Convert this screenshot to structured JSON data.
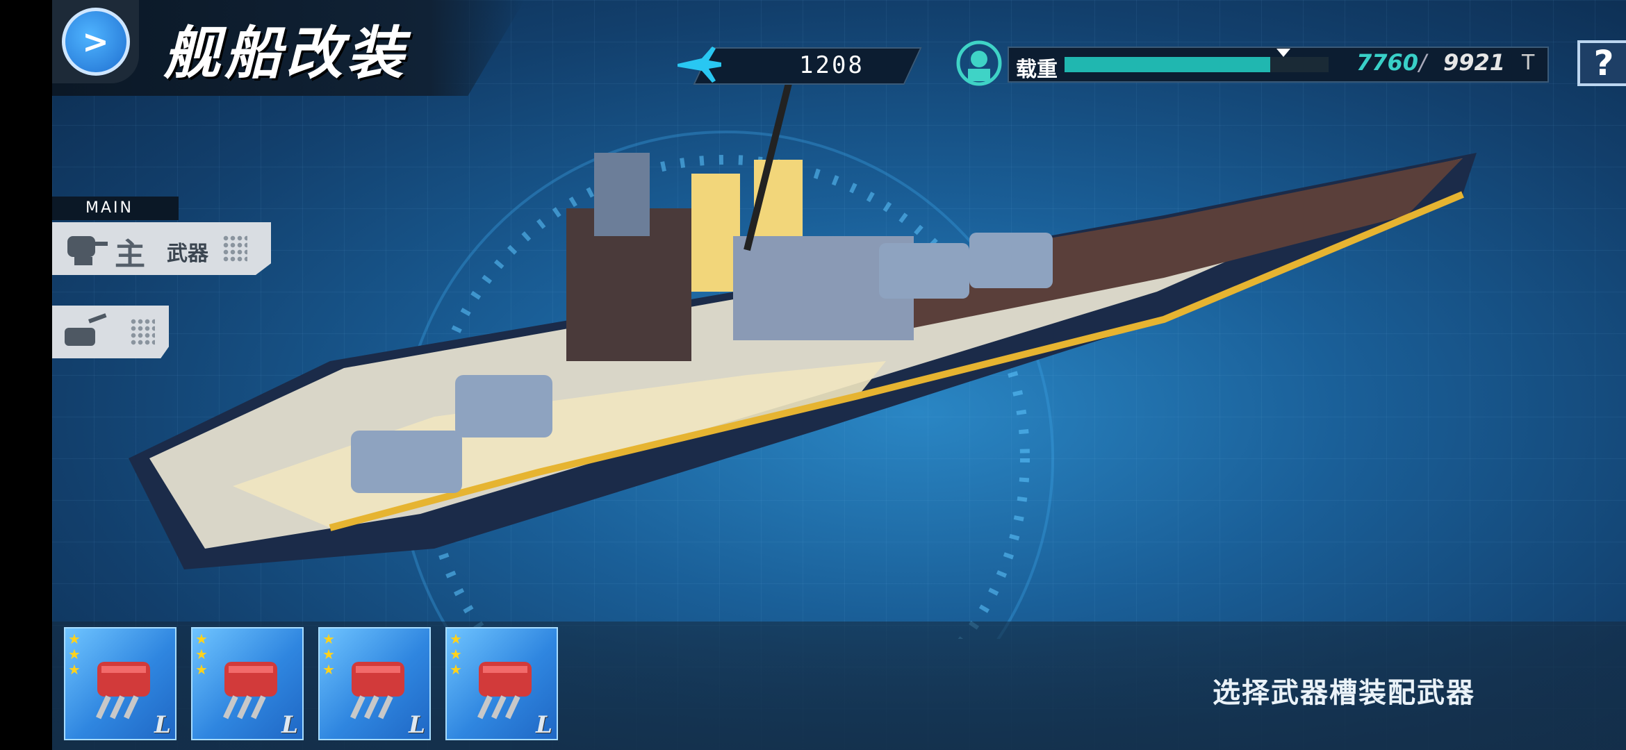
{
  "header": {
    "title": "舰船改装",
    "back_icon": "back-arrow-icon"
  },
  "resources": {
    "power_icon": "plane-icon",
    "power_value": "1208"
  },
  "load": {
    "label": "载重",
    "current": "7760",
    "separator": "/",
    "max": "9921",
    "unit": "T",
    "fill_fraction": 0.78,
    "color": "#20b7b0"
  },
  "help": {
    "label": "?"
  },
  "side_menu": {
    "section_tag": "MAIN",
    "main_weapon": {
      "mainchar": "主",
      "label": "武器"
    }
  },
  "slots": [
    {
      "stars": "★\n★\n★",
      "grade": "L"
    },
    {
      "stars": "★\n★\n★",
      "grade": "L"
    },
    {
      "stars": "★\n★\n★",
      "grade": "L"
    },
    {
      "stars": "★\n★\n★",
      "grade": "L"
    }
  ],
  "hint": "选择武器槽装配武器"
}
